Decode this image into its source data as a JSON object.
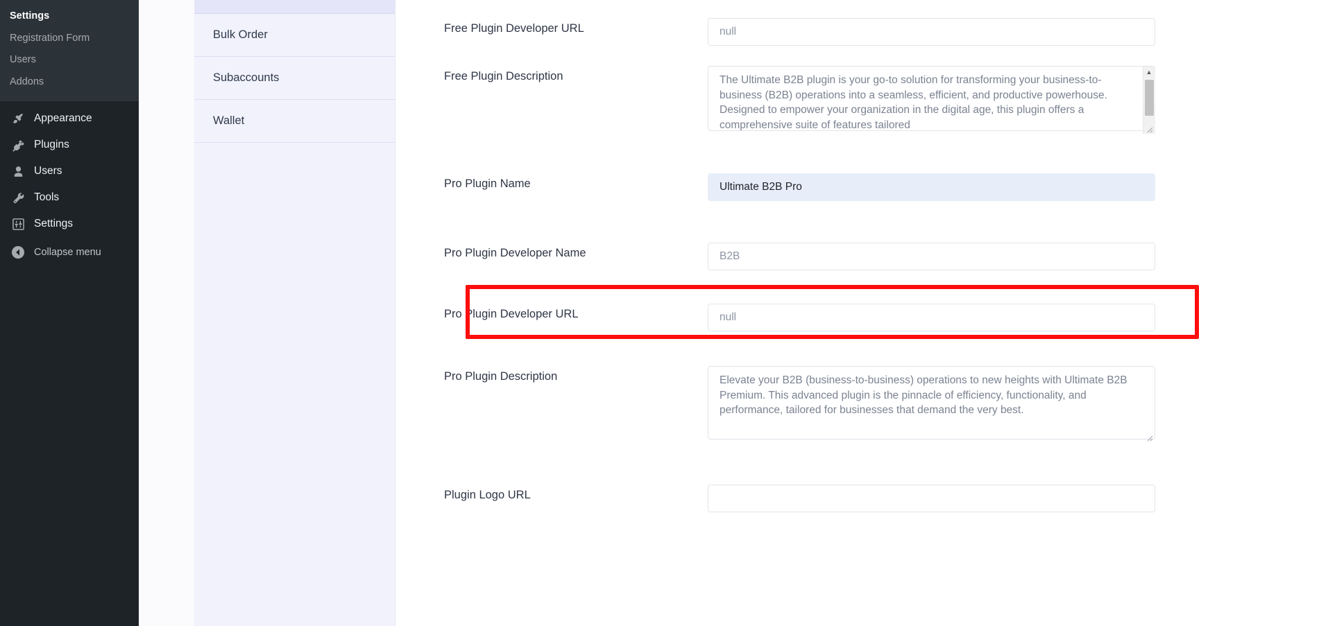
{
  "admin_sidebar": {
    "submenu": [
      {
        "label": "Settings",
        "current": true
      },
      {
        "label": "Registration Form",
        "current": false
      },
      {
        "label": "Users",
        "current": false
      },
      {
        "label": "Addons",
        "current": false
      }
    ],
    "menu": [
      {
        "label": "Appearance",
        "icon": "paintbrush-icon"
      },
      {
        "label": "Plugins",
        "icon": "plug-icon"
      },
      {
        "label": "Users",
        "icon": "user-icon"
      },
      {
        "label": "Tools",
        "icon": "wrench-icon"
      },
      {
        "label": "Settings",
        "icon": "sliders-icon"
      }
    ],
    "collapse": {
      "label": "Collapse menu",
      "icon": "collapse-arrow-icon"
    }
  },
  "nav_panel": {
    "items": [
      {
        "label": "Bulk Order",
        "active": false
      },
      {
        "label": "Subaccounts",
        "active": false
      },
      {
        "label": "Wallet",
        "active": false
      }
    ]
  },
  "form": {
    "fields": [
      {
        "name": "free-plugin-developer-url",
        "label": "Free Plugin Developer URL",
        "type": "text",
        "value": "",
        "placeholder": "null",
        "highlighted": false
      },
      {
        "name": "free-plugin-description",
        "label": "Free Plugin Description",
        "type": "textarea-scroll",
        "value": "The Ultimate B2B plugin is your go-to solution for transforming your business-to-business (B2B) operations into a seamless, efficient, and productive powerhouse. Designed to empower your organization in the digital age, this plugin offers a comprehensive suite of features tailored",
        "placeholder": ""
      },
      {
        "name": "pro-plugin-name",
        "label": "Pro Plugin Name",
        "type": "text",
        "value": "Ultimate B2B Pro",
        "placeholder": "",
        "highlighted": true
      },
      {
        "name": "pro-plugin-developer-name",
        "label": "Pro Plugin Developer Name",
        "type": "text",
        "value": "",
        "placeholder": "B2B",
        "highlighted": false,
        "annotated": true
      },
      {
        "name": "pro-plugin-developer-url",
        "label": "Pro Plugin Developer URL",
        "type": "text",
        "value": "",
        "placeholder": "null",
        "highlighted": false
      },
      {
        "name": "pro-plugin-description",
        "label": "Pro Plugin Description",
        "type": "textarea",
        "value": "Elevate your B2B (business-to-business) operations to new heights with Ultimate B2B Premium. This advanced plugin is the pinnacle of efficiency, functionality, and performance, tailored for businesses that demand the very best.",
        "placeholder": ""
      },
      {
        "name": "plugin-logo-url",
        "label": "Plugin Logo URL",
        "type": "text",
        "value": "",
        "placeholder": "",
        "highlighted": false
      }
    ],
    "scrollbar": {
      "up_arrow": "▲",
      "down_arrow": "▼"
    }
  },
  "colors": {
    "admin_bg": "#1d2327",
    "submenu_bg": "#2c3338",
    "nav_bg": "#f0f0fc",
    "nav_active": "#e5e5f9",
    "highlight_field": "#e8edfa",
    "annotation_red": "#ff0d0d",
    "page_bg": "#f6f7fb"
  }
}
